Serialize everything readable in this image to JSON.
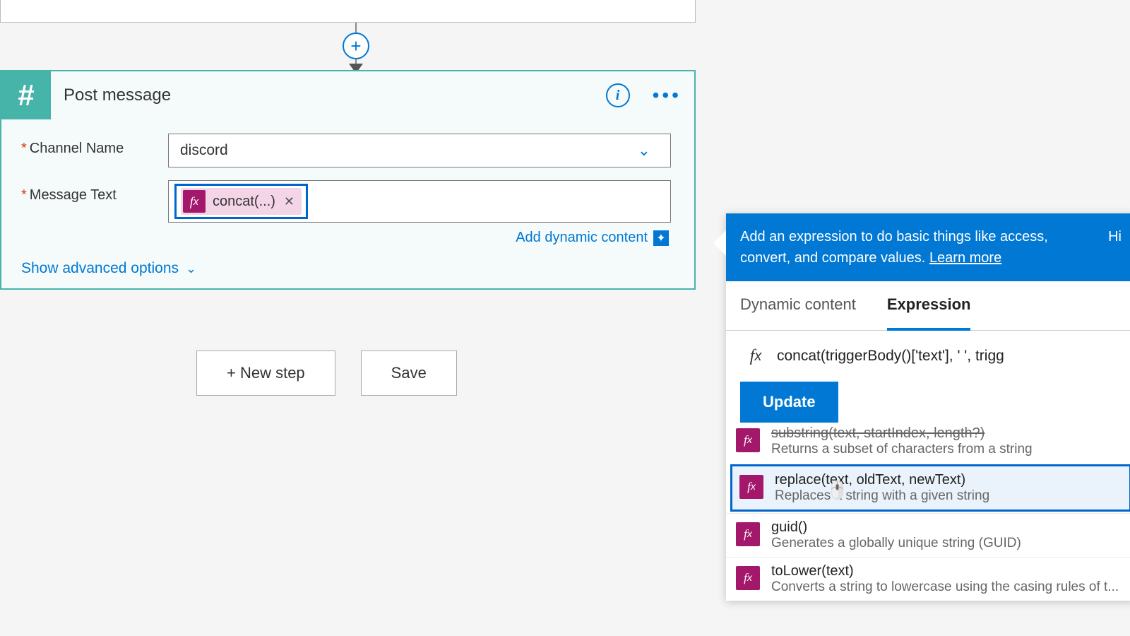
{
  "step": {
    "title": "Post message",
    "fields": {
      "channel": {
        "label": "Channel Name",
        "value": "discord"
      },
      "message": {
        "label": "Message Text",
        "token": "concat(...)"
      }
    },
    "dynamic_link": "Add dynamic content",
    "advanced": "Show advanced options"
  },
  "actions": {
    "new_step": "+ New step",
    "save": "Save"
  },
  "panel": {
    "hint_a": "Add an expression to do basic things like access, convert, and compare values.",
    "hint_learn": "Learn more",
    "hide": "Hi",
    "tabs": {
      "dynamic": "Dynamic content",
      "expression": "Expression"
    },
    "expr_value": "concat(triggerBody()['text'], ' ', trigg",
    "update": "Update",
    "functions": [
      {
        "sig": "substring(text, startIndex, length?)",
        "desc": "Returns a subset of characters from a string",
        "partial": true
      },
      {
        "sig": "replace(text, oldText, newText)",
        "desc": "Replaces a string with a given string",
        "highlighted": true
      },
      {
        "sig": "guid()",
        "desc": "Generates a globally unique string (GUID)"
      },
      {
        "sig": "toLower(text)",
        "desc": "Converts a string to lowercase using the casing rules of t..."
      }
    ]
  }
}
